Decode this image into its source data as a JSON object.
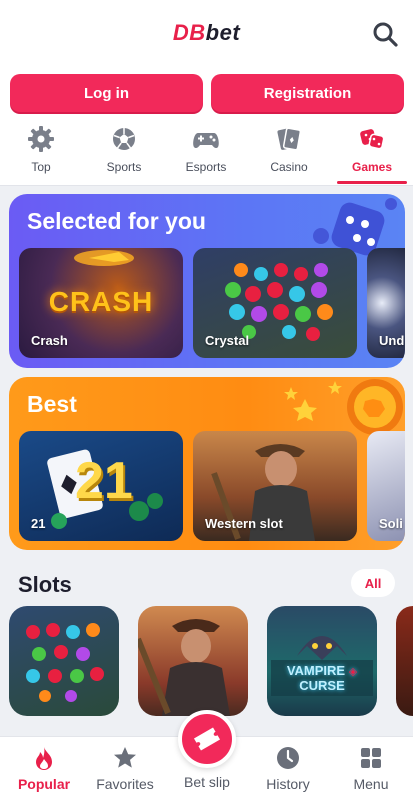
{
  "header": {
    "logo_part1": "DB",
    "logo_part2": "bet",
    "brand_color": "#e8204a",
    "search_icon": "search-icon"
  },
  "auth": {
    "login_label": "Log in",
    "registration_label": "Registration"
  },
  "tabs": [
    {
      "label": "Top",
      "icon": "gear-icon"
    },
    {
      "label": "Sports",
      "icon": "soccer-ball-icon"
    },
    {
      "label": "Esports",
      "icon": "gamepad-icon"
    },
    {
      "label": "Casino",
      "icon": "cards-icon"
    },
    {
      "label": "Games",
      "icon": "dice-icon",
      "active": true
    }
  ],
  "selected": {
    "title": "Selected for you",
    "cards": [
      {
        "label": "Crash"
      },
      {
        "label": "Crystal"
      },
      {
        "label": "Und"
      }
    ],
    "crash_art": "CRASH"
  },
  "best": {
    "title": "Best",
    "cards": [
      {
        "label": "21"
      },
      {
        "label": "Western slot"
      },
      {
        "label": "Soli"
      }
    ],
    "art_21": "21"
  },
  "slots": {
    "title": "Slots",
    "all_label": "All",
    "vampire_art_1": "VAMPIRE",
    "vampire_art_2": "CURSE"
  },
  "bottom_nav": {
    "items": [
      {
        "label": "Popular",
        "icon": "fire-icon",
        "active": true
      },
      {
        "label": "Favorites",
        "icon": "star-icon"
      },
      {
        "label": "Bet slip",
        "icon": "ticket-icon"
      },
      {
        "label": "History",
        "icon": "clock-icon"
      },
      {
        "label": "Menu",
        "icon": "grid-icon"
      }
    ]
  }
}
